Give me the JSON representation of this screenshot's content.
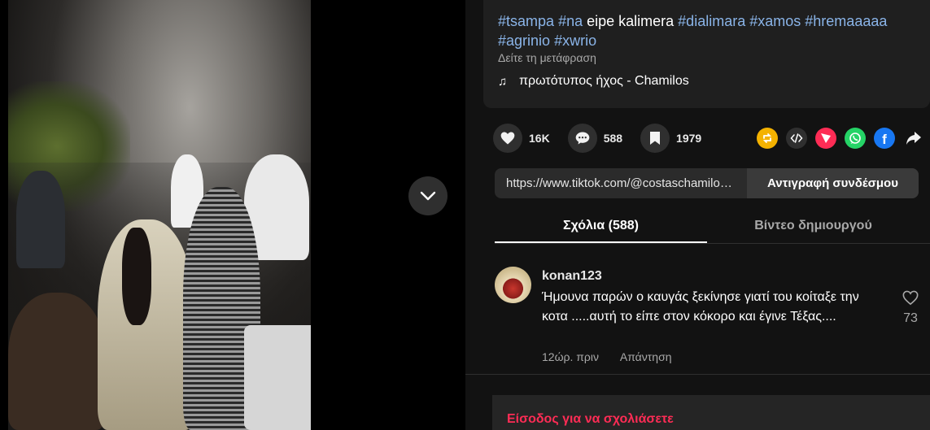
{
  "video": {
    "next_button_icon": "chevron-down-icon"
  },
  "description": {
    "parts": [
      {
        "text": "#tsampa",
        "tag": true
      },
      {
        "text": " ",
        "tag": false
      },
      {
        "text": "#na",
        "tag": true
      },
      {
        "text": " eipe kalimera ",
        "tag": false
      },
      {
        "text": "#dialimara",
        "tag": true
      },
      {
        "text": " ",
        "tag": false
      },
      {
        "text": "#xamos",
        "tag": true
      },
      {
        "text": " ",
        "tag": false
      },
      {
        "text": "#hremaaaaa",
        "tag": true
      },
      {
        "text": " ",
        "tag": false
      },
      {
        "text": "#agrinio",
        "tag": true
      },
      {
        "text": " ",
        "tag": false
      },
      {
        "text": "#xwrio",
        "tag": true
      }
    ],
    "translate_label": "Δείτε τη μετάφραση",
    "music_icon": "music-note-icon",
    "music_label": "πρωτότυπος ήχος - Chamilos"
  },
  "actions": {
    "likes": "16K",
    "comments": "588",
    "saves": "1979",
    "share_targets": [
      "repost-icon",
      "embed-icon",
      "send-icon",
      "whatsapp-icon",
      "facebook-icon",
      "share-arrow-icon"
    ]
  },
  "link": {
    "url": "https://www.tiktok.com/@costaschamilos/video/",
    "copy_label": "Αντιγραφή συνδέσμου"
  },
  "tabs": [
    {
      "label": "Σχόλια (588)",
      "active": true
    },
    {
      "label": "Βίντεο δημιουργού",
      "active": false
    }
  ],
  "comment": {
    "username": "konan123",
    "text": "Ήμουνα παρών ο καυγάς ξεκίνησε γιατί του κοίταξε την κοτα .....αυτή το είπε στον κόκορο και έγινε Τέξας....",
    "time": "12ώρ. πριν",
    "reply_label": "Απάντηση",
    "likes": "73"
  },
  "login": {
    "label": "Είσοδος για να σχολιάσετε"
  },
  "colors": {
    "accent": "#fe2c55",
    "hashtag": "#8ab4e8",
    "background": "#121212"
  }
}
